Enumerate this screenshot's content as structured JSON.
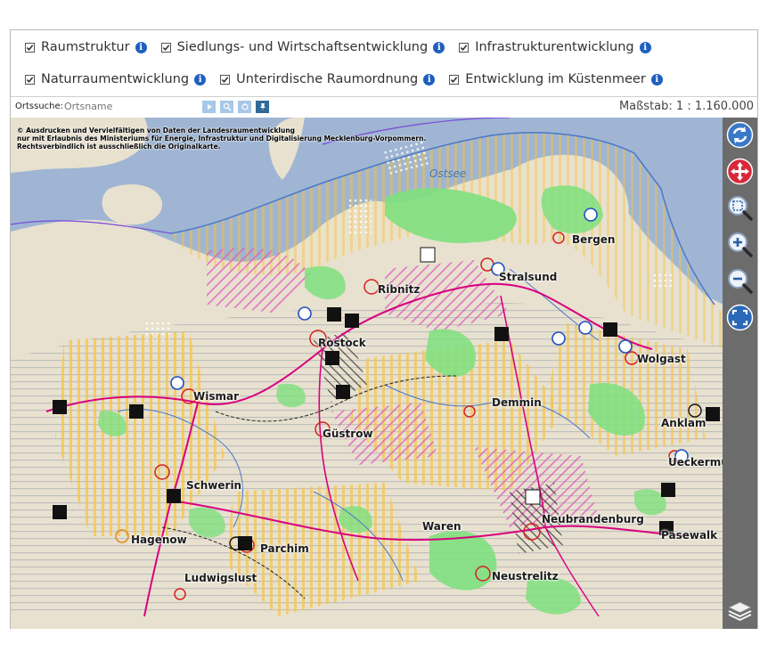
{
  "layers": [
    {
      "label": "Raumstruktur",
      "checked": true
    },
    {
      "label": "Siedlungs- und Wirtschaftsentwicklung",
      "checked": true
    },
    {
      "label": "Infrastrukturentwicklung",
      "checked": true
    },
    {
      "label": "Naturraumentwicklung",
      "checked": true
    },
    {
      "label": "Unterirdische Raumordnung",
      "checked": true
    },
    {
      "label": "Entwicklung im Küstenmeer",
      "checked": true
    }
  ],
  "info_icon_glyph": "i",
  "search": {
    "label": "Ortssuche:",
    "placeholder": "Ortsname"
  },
  "scale": "Maßstab: 1 : 1.160.000",
  "map": {
    "copyright": [
      "© Ausdrucken und Vervielfältigen von Daten der Landesraumentwicklung",
      "nur mit Erlaubnis des Ministeriums für Energie, Infrastruktur und Digitalisierung Mecklenburg-Vorpommern.",
      "Rechtsverbindlich ist ausschließlich die Originalkarte."
    ],
    "sea_label": "Ostsee",
    "places": [
      "Bergen",
      "Stralsund",
      "Ribnitz",
      "Rostock",
      "Wolgast",
      "Wismar",
      "Demmin",
      "Güstrow",
      "Anklam",
      "Ueckermünde",
      "Schwerin",
      "Neubrandenburg",
      "Waren",
      "Pasewalk",
      "Hagenow",
      "Parchim",
      "Neustrelitz",
      "Ludwigslust"
    ],
    "colors": {
      "sea": "#9fb5d3",
      "land": "#e8e1cf",
      "nature": "#7ee07e",
      "hatch_yellow": "#f5c542",
      "hatch_pink": "#e05ac2",
      "road": "#d8007f",
      "border_blue": "#4a78c8"
    }
  },
  "toolbar": [
    {
      "name": "refresh-icon"
    },
    {
      "name": "pan-icon"
    },
    {
      "name": "zoom-box-icon"
    },
    {
      "name": "zoom-in-icon"
    },
    {
      "name": "zoom-out-icon"
    },
    {
      "name": "full-extent-icon"
    },
    {
      "name": "layers-icon"
    }
  ]
}
